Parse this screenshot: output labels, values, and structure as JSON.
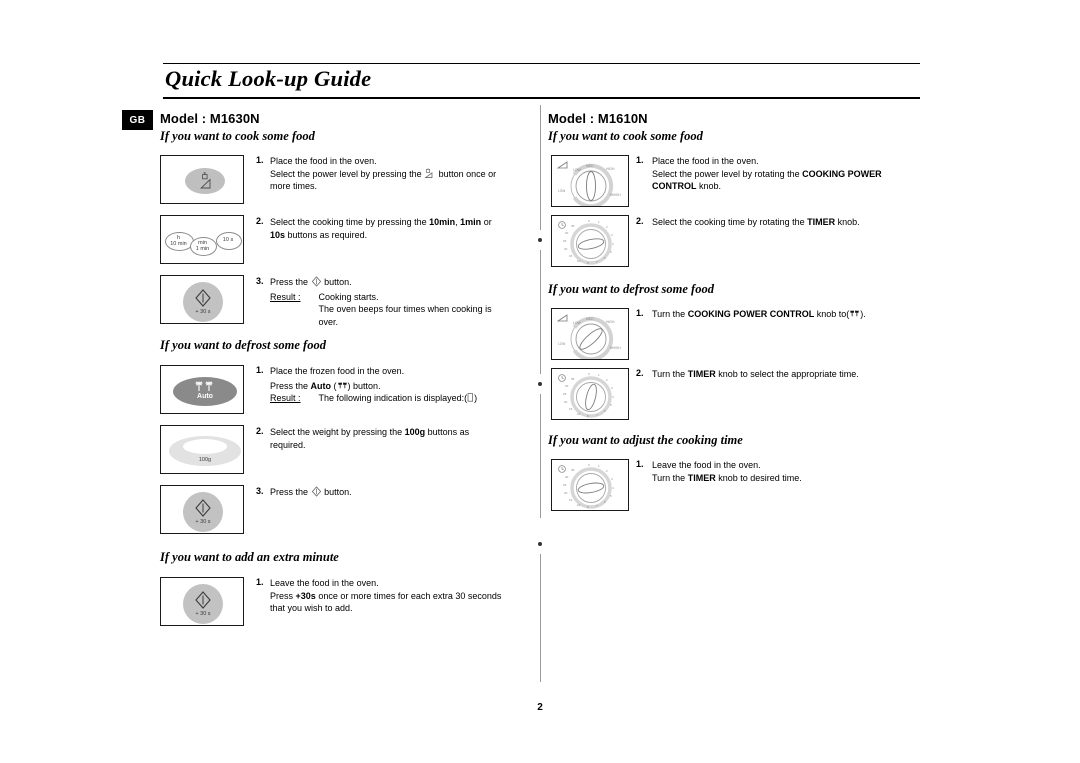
{
  "document": {
    "title": "Quick Look-up Guide",
    "page_number": "2",
    "locale_badge": "GB"
  },
  "left_column": {
    "model_heading": "Model : M1630N",
    "sections": [
      {
        "heading": "If you want to cook some food",
        "steps": [
          {
            "number": "1.",
            "lines": [
              "Place the food in the oven.",
              "Select the power level by pressing the ⟨power-icon⟩ button once or",
              "more times."
            ],
            "illustration": "power-level-button"
          },
          {
            "number": "2.",
            "lines": [
              "Select the cooking time by pressing the 10min, 1min or",
              "10s buttons as required."
            ],
            "illustration": "time-buttons"
          },
          {
            "number": "3.",
            "lines": [
              "Press the ⟨start-icon⟩ button."
            ],
            "result_label": "Result :",
            "result_lines": [
              "Cooking starts.",
              "The oven beeps four times when cooking is",
              "over."
            ],
            "illustration": "start-30s-button"
          }
        ]
      },
      {
        "heading": "If you want to defrost some food",
        "steps": [
          {
            "number": "1.",
            "lines": [
              "Place the frozen food in the oven.",
              "Press the Auto ( ⟨defrost-icon⟩ ) button."
            ],
            "result_label": "Result :",
            "result_lines": [
              "The following indication is displayed:( ⟨display-icon⟩ )"
            ],
            "illustration": "auto-defrost-button"
          },
          {
            "number": "2.",
            "lines": [
              "Select the weight by pressing the 100g buttons as",
              "required."
            ],
            "illustration": "weight-100g-button"
          },
          {
            "number": "3.",
            "lines": [
              "Press the ⟨start-icon⟩ button."
            ],
            "illustration": "start-30s-button"
          }
        ]
      },
      {
        "heading": "If you want to add an extra minute",
        "steps": [
          {
            "number": "1.",
            "lines": [
              "Leave the food in the oven.",
              "Press +30s once or more times for each extra 30 seconds",
              "that you wish to add."
            ],
            "illustration": "start-30s-button"
          }
        ]
      }
    ]
  },
  "right_column": {
    "model_heading": "Model : M1610N",
    "sections": [
      {
        "heading": "If you want to cook some food",
        "steps": [
          {
            "number": "1.",
            "lines": [
              "Place the food in the oven.",
              "Select the power level by rotating the COOKING POWER",
              "CONTROL knob."
            ],
            "illustration": "cooking-power-control-knob"
          },
          {
            "number": "2.",
            "lines": [
              "Select the cooking time by rotating the TIMER knob."
            ],
            "illustration": "timer-knob"
          }
        ]
      },
      {
        "heading": "If you want to defrost some food",
        "steps": [
          {
            "number": "1.",
            "lines": [
              "Turn the COOKING POWER CONTROL knob to( ⟨defrost-icon⟩ )."
            ],
            "illustration": "cooking-power-control-knob"
          },
          {
            "number": "2.",
            "lines": [
              "Turn the TIMER knob to select the appropriate time."
            ],
            "illustration": "timer-knob"
          }
        ]
      },
      {
        "heading": "If you want to adjust the cooking time",
        "steps": [
          {
            "number": "1.",
            "lines": [
              "Leave the food in the oven.",
              "Turn the TIMER knob to desired time."
            ],
            "illustration": "timer-knob"
          }
        ]
      }
    ]
  },
  "illustration_labels": {
    "time_button_1_top": "h",
    "time_button_1_bottom": "10 min",
    "time_button_2_top": "min",
    "time_button_2_bottom": "1 min",
    "time_button_3": "10 s",
    "start_button": "+ 30 s",
    "auto_button": "Auto",
    "weight_button": "100g",
    "power_knob_ticks": [
      "LOW",
      "MEDIUM LOW",
      "MEDIUM",
      "MEDIUM HIGH",
      "HIGH"
    ],
    "timer_knob_ticks": [
      "0",
      "1",
      "2",
      "3",
      "4",
      "5",
      "6",
      "7",
      "8",
      "10",
      "15",
      "20",
      "25",
      "30",
      "35"
    ]
  },
  "text_fragments": {
    "step_text_parts": {
      "l1s1_a": "Place the food in the oven.",
      "l1s1_b": "Select the power level by pressing the",
      "l1s1_c": "button once or",
      "l1s1_d": "more times.",
      "l1s2_a": "Select the cooking time by pressing the",
      "l1s2_b": "10min",
      "l1s2_c": ",",
      "l1s2_d": "1min",
      "l1s2_e": "or",
      "l1s2_f": "10s",
      "l1s2_g": "buttons as required.",
      "l1s3_a": "Press the",
      "l1s3_b": "button.",
      "l1s3_result": "Result :",
      "l1s3_r1": "Cooking starts.",
      "l1s3_r2": "The oven beeps four times when cooking is",
      "l1s3_r3": "over.",
      "l2s1_a": "Place the frozen food in the oven.",
      "l2s1_b": "Press the",
      "l2s1_auto": "Auto",
      "l2s1_c": ") button.",
      "l2s1_result": "Result :",
      "l2s1_r1": "The following indication is displayed:(",
      "l2s1_r2": ")",
      "l2s2_a": "Select the weight by pressing the",
      "l2s2_b": "100g",
      "l2s2_c": "buttons as",
      "l2s2_d": "required.",
      "l2s3_a": "Press the",
      "l2s3_b": "button.",
      "l3s1_a": "Leave the food in the oven.",
      "l3s1_b": "Press",
      "l3s1_c": "+30s",
      "l3s1_d": "once or more times for each extra 30 seconds",
      "l3s1_e": "that you wish to add.",
      "r1s1_a": "Place the food in the oven.",
      "r1s1_b": "Select the power level by rotating the",
      "r1s1_c": "COOKING POWER",
      "r1s1_d": "CONTROL",
      "r1s1_e": "knob.",
      "r1s2_a": "Select the cooking time by rotating the",
      "r1s2_b": "TIMER",
      "r1s2_c": "knob.",
      "r2s1_a": "Turn the",
      "r2s1_b": "COOKING POWER CONTROL",
      "r2s1_c": "knob to(",
      "r2s1_d": ").",
      "r2s2_a": "Turn the",
      "r2s2_b": "TIMER",
      "r2s2_c": "knob to select the appropriate time.",
      "r3s1_a": "Leave the food in the oven.",
      "r3s1_b": "Turn the",
      "r3s1_c": "TIMER",
      "r3s1_d": "knob to desired time."
    }
  },
  "colors": {
    "text": "#000000",
    "badge_bg": "#000000",
    "badge_fg": "#ffffff",
    "key_gray": "#bfbfbf",
    "key_dark_gray": "#8a8a8a",
    "key_light_gray": "#e2e2e2",
    "divider": "#9a9a9a"
  }
}
